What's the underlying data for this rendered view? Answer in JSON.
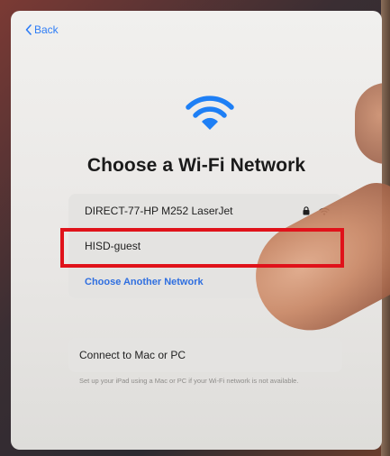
{
  "nav": {
    "back_label": "Back"
  },
  "title": "Choose a Wi-Fi Network",
  "networks": [
    {
      "name": "DIRECT-77-HP M252 LaserJet",
      "secured": true,
      "signal_icon": "wifi-icon"
    },
    {
      "name": "HISD-guest",
      "secured": false
    }
  ],
  "choose_another": "Choose Another Network",
  "connect_mac_pc": "Connect to Mac or PC",
  "footnote": "Set up your iPad using a Mac or PC if your Wi-Fi network is not available.",
  "colors": {
    "accent": "#2e7df6",
    "highlight": "#e0121a"
  }
}
